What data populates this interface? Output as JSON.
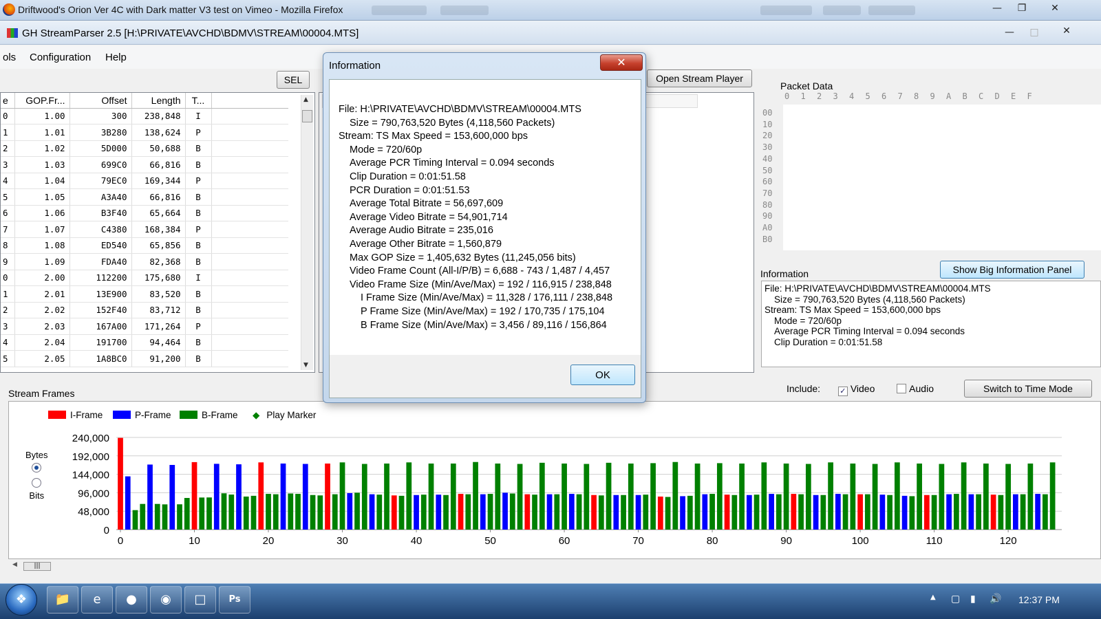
{
  "firefox": {
    "title": "Driftwood's Orion Ver 4C with Dark matter V3 test on Vimeo - Mozilla Firefox"
  },
  "app": {
    "title": "GH StreamParser 2.5 [H:\\PRIVATE\\AVCHD\\BDMV\\STREAM\\00004.MTS]"
  },
  "menu": {
    "items": [
      "ols",
      "Configuration",
      "Help"
    ]
  },
  "toolbar": {
    "sel_label": "SEL",
    "open_player_label": "Open Stream Player"
  },
  "gop_table": {
    "headers": [
      "e",
      "GOP.Fr...",
      "Offset",
      "Length",
      "T..."
    ],
    "rows": [
      [
        "0",
        "1.00",
        "300",
        "238,848",
        "I"
      ],
      [
        "1",
        "1.01",
        "3B280",
        "138,624",
        "P"
      ],
      [
        "2",
        "1.02",
        "5D000",
        "50,688",
        "B"
      ],
      [
        "3",
        "1.03",
        "699C0",
        "66,816",
        "B"
      ],
      [
        "4",
        "1.04",
        "79EC0",
        "169,344",
        "P"
      ],
      [
        "5",
        "1.05",
        "A3A40",
        "66,816",
        "B"
      ],
      [
        "6",
        "1.06",
        "B3F40",
        "65,664",
        "B"
      ],
      [
        "7",
        "1.07",
        "C4380",
        "168,384",
        "P"
      ],
      [
        "8",
        "1.08",
        "ED540",
        "65,856",
        "B"
      ],
      [
        "9",
        "1.09",
        "FDA40",
        "82,368",
        "B"
      ],
      [
        "0",
        "2.00",
        "112200",
        "175,680",
        "I"
      ],
      [
        "1",
        "2.01",
        "13E900",
        "83,520",
        "B"
      ],
      [
        "2",
        "2.02",
        "152F40",
        "83,712",
        "B"
      ],
      [
        "3",
        "2.03",
        "167A00",
        "171,264",
        "P"
      ],
      [
        "4",
        "2.04",
        "191700",
        "94,464",
        "B"
      ],
      [
        "5",
        "2.05",
        "1A8BC0",
        "91,200",
        "B"
      ]
    ]
  },
  "packet": {
    "label": "Packet Data",
    "cols": [
      "0",
      "1",
      "2",
      "3",
      "4",
      "5",
      "6",
      "7",
      "8",
      "9",
      "A",
      "B",
      "C",
      "D",
      "E",
      "F"
    ],
    "rows": [
      "00",
      "10",
      "20",
      "30",
      "40",
      "50",
      "60",
      "70",
      "80",
      "90",
      "A0",
      "B0"
    ]
  },
  "info_panel": {
    "label": "Information",
    "big_button": "Show Big Information Panel",
    "lines": [
      "File: H:\\PRIVATE\\AVCHD\\BDMV\\STREAM\\00004.MTS",
      "Size = 790,763,520 Bytes (4,118,560 Packets)",
      "Stream: TS Max Speed = 153,600,000 bps",
      "Mode = 720/60p",
      "Average PCR Timing Interval = 0.094 seconds",
      "Clip Duration = 0:01:51.58"
    ]
  },
  "include": {
    "label": "Include:",
    "video": "Video",
    "audio": "Audio",
    "video_checked": true,
    "audio_checked": false
  },
  "switch_button": "Switch to Time Mode",
  "stream_frames_label": "Stream Frames",
  "legend": {
    "i": "I-Frame",
    "p": "P-Frame",
    "b": "B-Frame",
    "marker": "Play Marker"
  },
  "units": {
    "bytes": "Bytes",
    "bits": "Bits",
    "selected": "bytes"
  },
  "colors": {
    "i_frame": "#ff0000",
    "p_frame": "#0000ff",
    "b_frame": "#008000",
    "marker": "#008000"
  },
  "chart_data": {
    "type": "bar",
    "ylim": [
      0,
      240000
    ],
    "yticks": [
      "240,000",
      "192,000",
      "144,000",
      "96,000",
      "48,000",
      "0"
    ],
    "xticks": [
      "0",
      "10",
      "20",
      "30",
      "40",
      "50",
      "60",
      "70",
      "80",
      "90",
      "100",
      "110",
      "120"
    ],
    "pattern": "I P B B P B B P B B per GOP, repeating",
    "values": [
      238848,
      138624,
      50688,
      66816,
      169344,
      66816,
      65664,
      168384,
      65856,
      82368,
      175680,
      83520,
      83712,
      171264,
      94464,
      91200,
      170000,
      86000,
      88000,
      175000,
      93000,
      92000,
      172000,
      94000,
      93000,
      171000,
      90000,
      89000,
      172000,
      92000,
      175000,
      95000,
      96000,
      171000,
      92000,
      91000,
      172000,
      89000,
      88000,
      175000,
      90000,
      91000,
      172000,
      91000,
      90000,
      172000,
      93000,
      92000,
      176000,
      92000,
      93000,
      172000,
      96000,
      94000,
      171000,
      92000,
      91000,
      174000,
      92000,
      92000,
      172000,
      93000,
      92000,
      171000,
      90000,
      89000,
      174000,
      90000,
      90000,
      172000,
      90000,
      91000,
      173000,
      86000,
      85000,
      176000,
      87000,
      88000,
      172000,
      92000,
      93000,
      173000,
      91000,
      90000,
      172000,
      90000,
      91000,
      175000,
      93000,
      92000,
      172000,
      93000,
      92000,
      171000,
      90000,
      90000,
      175000,
      93000,
      92000,
      172000,
      92000,
      92000,
      171000,
      91000,
      90000,
      175000,
      88000,
      87000,
      172000,
      90000,
      90000,
      171000,
      92000,
      93000,
      175000,
      92000,
      92000,
      172000,
      91000,
      90000,
      171000,
      92000,
      92000,
      172000,
      93000,
      92000,
      175000
    ],
    "types": "IPBBPBBPBBIBBPBBPBBIBBPBBPBBIBBPBBPBBIBBPBBPBBIBBPBBPBBIBBPBBPBBIBBPBBPBBIBBPBBPBBIBBPBBPBBIBBPBBPBBIBBPBBPBBIBBPBBPBBIBBPBBPBBI"
  },
  "dialog": {
    "title": "Information",
    "ok": "OK",
    "lines": [
      {
        "t": "File: H:\\PRIVATE\\AVCHD\\BDMV\\STREAM\\00004.MTS",
        "lvl": 0
      },
      {
        "t": "Size = 790,763,520 Bytes (4,118,560 Packets)",
        "lvl": 1
      },
      {
        "t": "Stream: TS Max Speed = 153,600,000 bps",
        "lvl": 0
      },
      {
        "t": "Mode = 720/60p",
        "lvl": 1
      },
      {
        "t": "Average PCR Timing Interval = 0.094 seconds",
        "lvl": 1
      },
      {
        "t": "Clip Duration = 0:01:51.58",
        "lvl": 1
      },
      {
        "t": "PCR Duration = 0:01:51.53",
        "lvl": 1
      },
      {
        "t": "Average Total Bitrate = 56,697,609",
        "lvl": 1
      },
      {
        "t": "Average Video Bitrate = 54,901,714",
        "lvl": 1
      },
      {
        "t": "Average Audio Bitrate = 235,016",
        "lvl": 1
      },
      {
        "t": "Average Other Bitrate = 1,560,879",
        "lvl": 1
      },
      {
        "t": "Max GOP Size = 1,405,632 Bytes (11,245,056 bits)",
        "lvl": 1
      },
      {
        "t": "Video Frame Count (All-I/P/B) = 6,688 - 743 / 1,487 / 4,457",
        "lvl": 1
      },
      {
        "t": "Video Frame Size (Min/Ave/Max) = 192 / 116,915 / 238,848",
        "lvl": 1
      },
      {
        "t": "I Frame Size (Min/Ave/Max) = 11,328 / 176,111 / 238,848",
        "lvl": 2
      },
      {
        "t": "P Frame Size (Min/Ave/Max) = 192 / 170,735 / 175,104",
        "lvl": 2
      },
      {
        "t": "B Frame Size (Min/Ave/Max) = 3,456 / 89,116 / 156,864",
        "lvl": 2
      }
    ]
  },
  "taskbar": {
    "clock": "12:37 PM"
  }
}
